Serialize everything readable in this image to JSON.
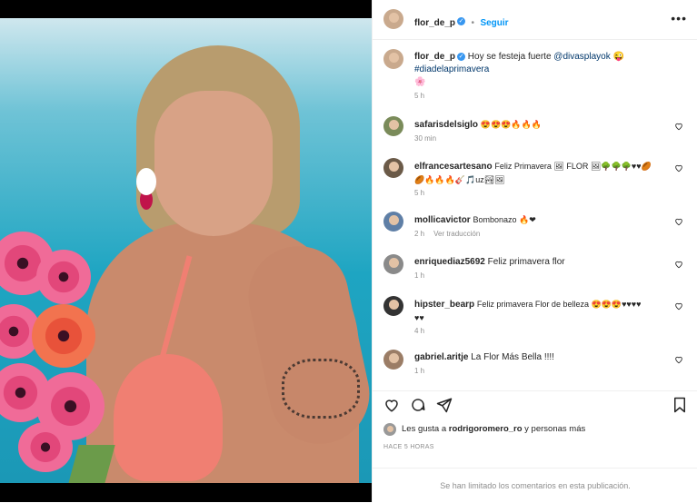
{
  "post": {
    "username": "flor_de_p",
    "follow_label": "Seguir",
    "caption_text": "Hoy se festeja fuerte ",
    "caption_mention": "@divasplayok",
    "caption_emoji": "😜",
    "caption_hashtag": "#diadelaprimavera",
    "caption_flower": "🌸",
    "caption_time": "5 h"
  },
  "comments": [
    {
      "user": "safarisdelsiglo",
      "text": "😍😍😍🔥🔥🔥",
      "time": "30 min"
    },
    {
      "user": "elfrancesartesano",
      "text": "Feliz Primavera 🖼 FLOR 🖼🌳🌳🌳♥♥🏉",
      "text2": "🏉🔥🔥🔥🎸🎵uz🏞🖼",
      "time": "5 h"
    },
    {
      "user": "mollicavictor",
      "text": "Bombonazo 🔥❤",
      "time": "2 h",
      "translate": "Ver traducción"
    },
    {
      "user": "enriquediaz5692",
      "text": "Feliz primavera flor",
      "time": "1 h"
    },
    {
      "user": "hipster_bearp",
      "text": "Feliz primavera Flor de belleza 😍😍😍♥♥♥♥",
      "text2": "♥♥",
      "time": "4 h"
    },
    {
      "user": "gabriel.aritje",
      "text": "La Flor Más Bella !!!!",
      "time": "1 h"
    }
  ],
  "likes": {
    "prefix": "Les gusta a ",
    "user": "rodrigoromero_ro",
    "suffix": " y personas más"
  },
  "posted_ago": "HACE 5 HORAS",
  "comments_limited": "Se han limitado los comentarios en esta publicación."
}
